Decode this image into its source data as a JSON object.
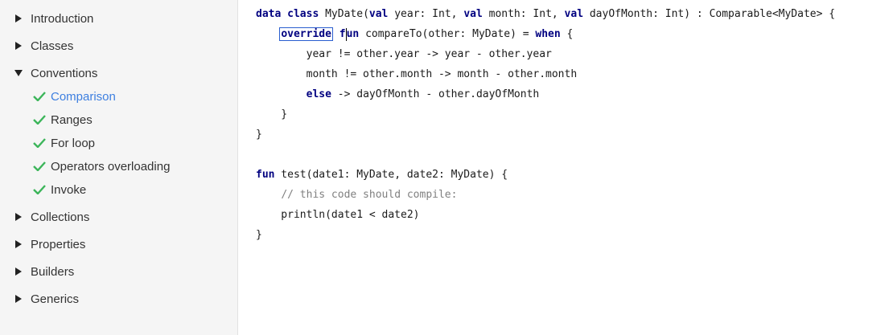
{
  "sidebar": {
    "items": [
      {
        "label": "Introduction",
        "state": "collapsed"
      },
      {
        "label": "Classes",
        "state": "collapsed"
      },
      {
        "label": "Conventions",
        "state": "expanded"
      },
      {
        "label": "Collections",
        "state": "collapsed"
      },
      {
        "label": "Properties",
        "state": "collapsed"
      },
      {
        "label": "Builders",
        "state": "collapsed"
      },
      {
        "label": "Generics",
        "state": "collapsed"
      }
    ],
    "sub_items": [
      {
        "label": "Comparison",
        "active": true
      },
      {
        "label": "Ranges",
        "active": false
      },
      {
        "label": "For loop",
        "active": false
      },
      {
        "label": "Operators overloading",
        "active": false
      },
      {
        "label": "Invoke",
        "active": false
      }
    ]
  },
  "editor": {
    "lines": [
      [
        {
          "t": "data class",
          "k": "kw"
        },
        {
          "t": " MyDate(",
          "k": ""
        },
        {
          "t": "val",
          "k": "kw"
        },
        {
          "t": " year: Int, ",
          "k": ""
        },
        {
          "t": "val",
          "k": "kw"
        },
        {
          "t": " month: Int, ",
          "k": ""
        },
        {
          "t": "val",
          "k": "kw"
        },
        {
          "t": " dayOfMonth: Int) : Comparable<MyDate> {",
          "k": ""
        }
      ],
      [
        {
          "t": "    ",
          "k": ""
        },
        {
          "t": "override",
          "k": "kw box"
        },
        {
          "t": " f",
          "k": "kw"
        },
        {
          "t": "",
          "k": "cursor"
        },
        {
          "t": "un",
          "k": "kw"
        },
        {
          "t": " compareTo(other: MyDate) = ",
          "k": ""
        },
        {
          "t": "when",
          "k": "kw"
        },
        {
          "t": " {",
          "k": ""
        }
      ],
      [
        {
          "t": "        year != other.year -> year - other.year",
          "k": ""
        }
      ],
      [
        {
          "t": "        month != other.month -> month - other.month",
          "k": ""
        }
      ],
      [
        {
          "t": "        ",
          "k": ""
        },
        {
          "t": "else",
          "k": "kw"
        },
        {
          "t": " -> dayOfMonth - other.dayOfMonth",
          "k": ""
        }
      ],
      [
        {
          "t": "    }",
          "k": ""
        }
      ],
      [
        {
          "t": "}",
          "k": ""
        }
      ],
      [
        {
          "t": "",
          "k": ""
        }
      ],
      [
        {
          "t": "fun",
          "k": "kw"
        },
        {
          "t": " test(date1: MyDate, date2: MyDate) {",
          "k": ""
        }
      ],
      [
        {
          "t": "    ",
          "k": ""
        },
        {
          "t": "// this code should compile:",
          "k": "cm"
        }
      ],
      [
        {
          "t": "    println(date1 < date2)",
          "k": ""
        }
      ],
      [
        {
          "t": "}",
          "k": ""
        }
      ]
    ]
  },
  "colors": {
    "active_link": "#3d7fe0",
    "check": "#3cb55a",
    "keyword": "#000080",
    "comment": "#808080",
    "sidebar_bg": "#f5f5f5"
  }
}
